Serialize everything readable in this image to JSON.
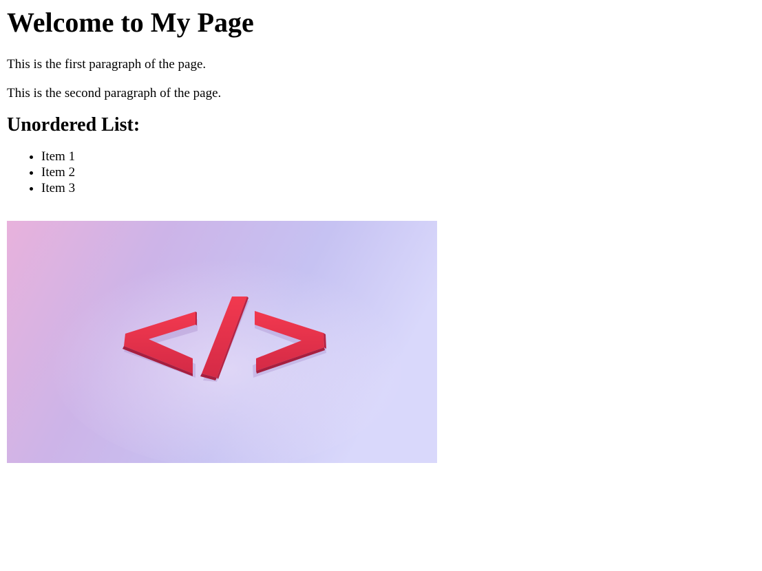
{
  "page": {
    "heading": "Welcome to My Page",
    "paragraphs": [
      "This is the first paragraph of the page.",
      "This is the second paragraph of the page."
    ],
    "list_heading": "Unordered List:",
    "list_items": [
      "Item 1",
      "Item 2",
      "Item 3"
    ]
  },
  "image": {
    "icon": "code-tag-icon",
    "glyph_color": "#f0304a",
    "background_colors": [
      "#e5b0dd",
      "#c8bff0",
      "#d8d6fb"
    ]
  }
}
